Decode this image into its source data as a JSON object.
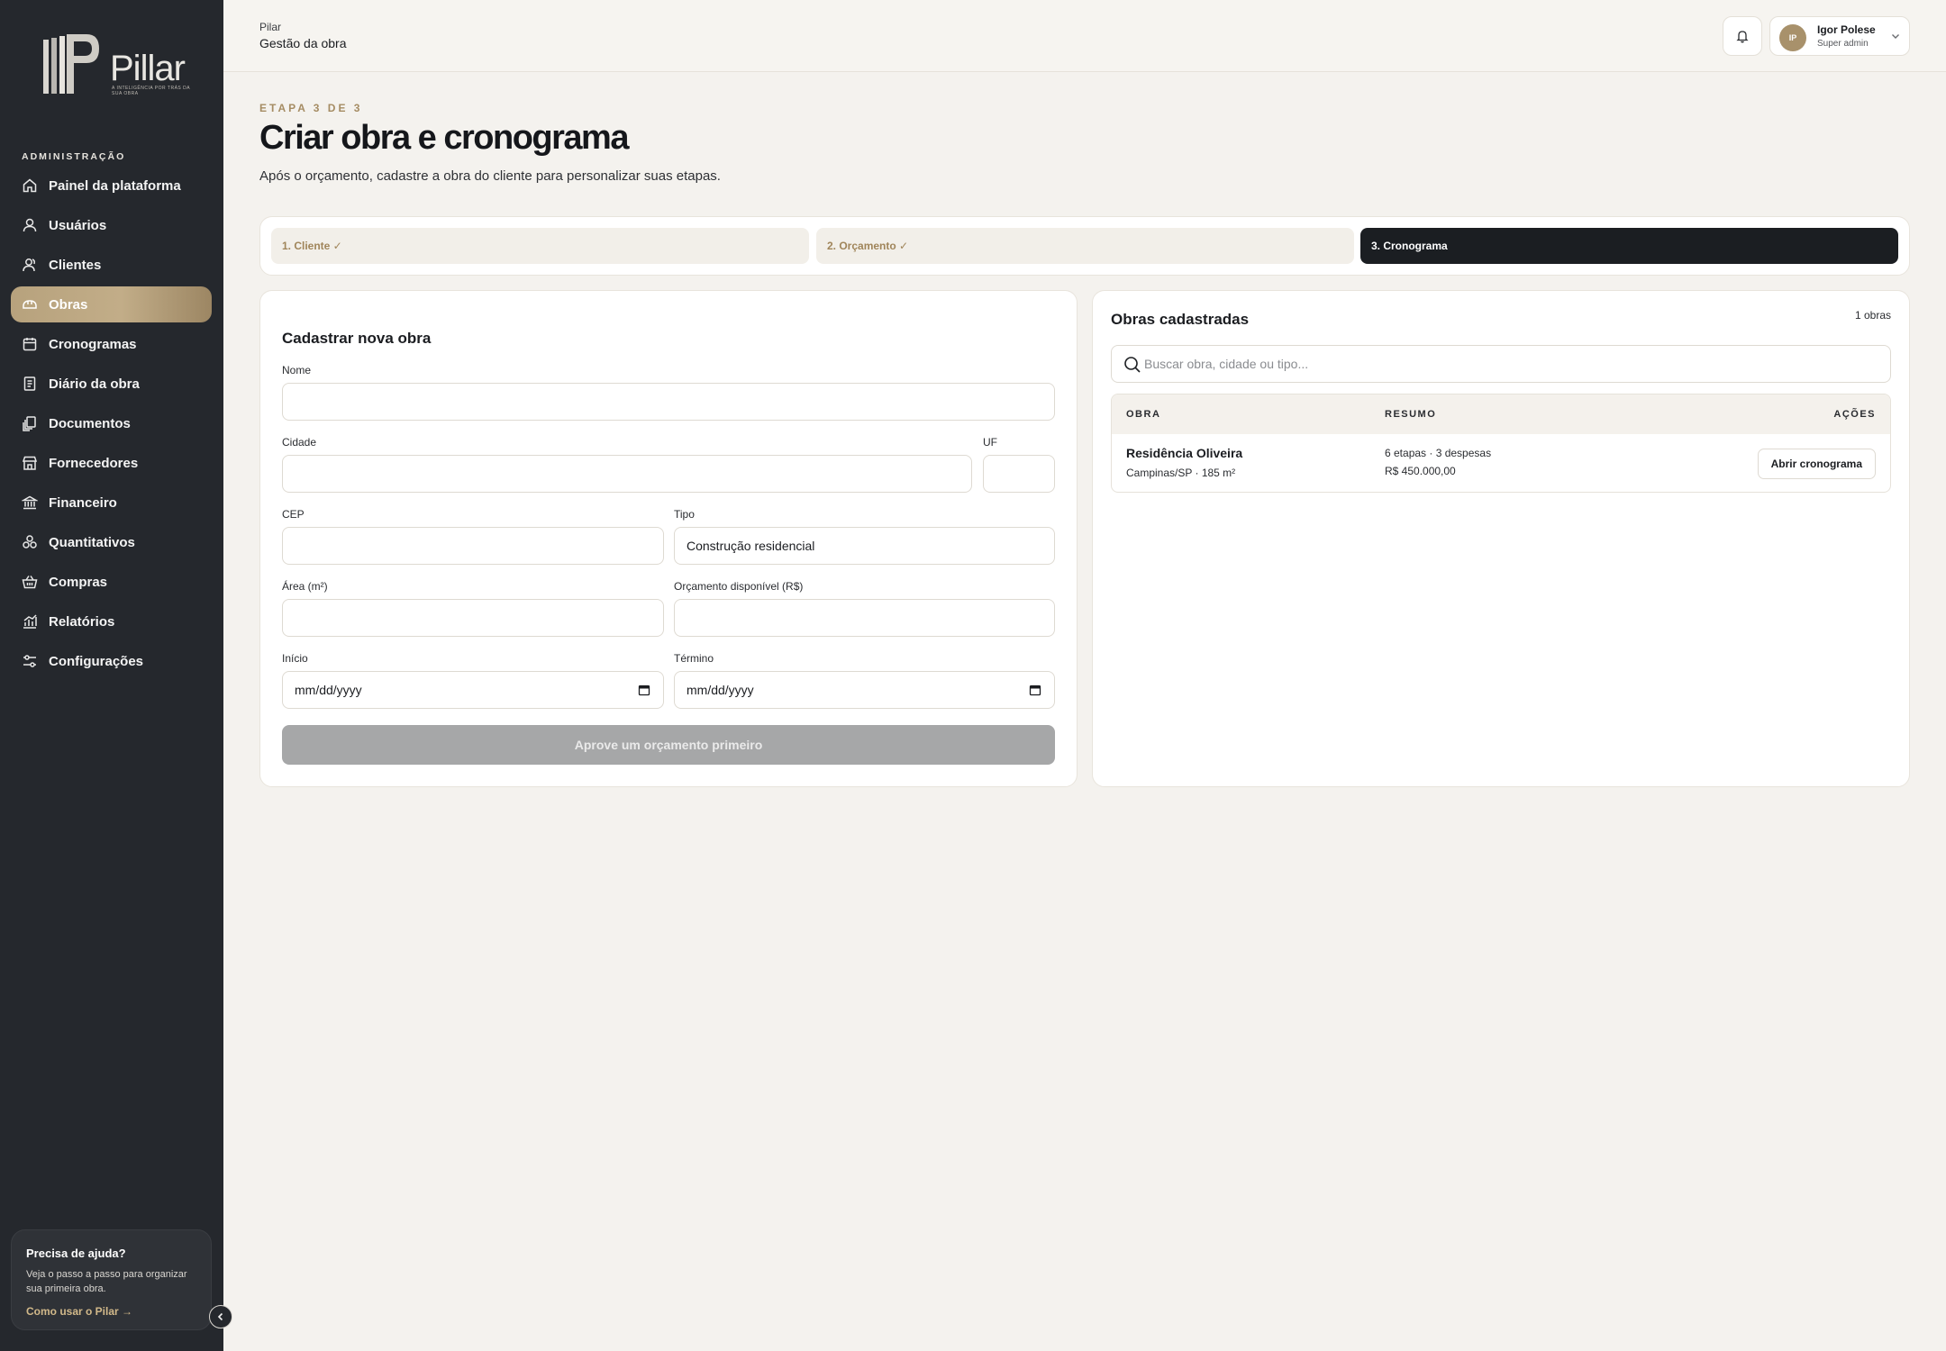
{
  "brand": {
    "name": "Pillar",
    "tagline": "A INTELIGÊNCIA POR TRÁS DA SUA OBRA"
  },
  "sidebar": {
    "section_label": "ADMINISTRAÇÃO",
    "items": [
      {
        "label": "Painel da plataforma",
        "icon": "home-icon"
      },
      {
        "label": "Usuários",
        "icon": "user-icon"
      },
      {
        "label": "Clientes",
        "icon": "users-icon"
      },
      {
        "label": "Obras",
        "icon": "helmet-icon",
        "active": true
      },
      {
        "label": "Cronogramas",
        "icon": "calendar-icon"
      },
      {
        "label": "Diário da obra",
        "icon": "notebook-icon"
      },
      {
        "label": "Documentos",
        "icon": "documents-icon"
      },
      {
        "label": "Fornecedores",
        "icon": "store-icon"
      },
      {
        "label": "Financeiro",
        "icon": "bank-icon"
      },
      {
        "label": "Quantitativos",
        "icon": "boxes-icon"
      },
      {
        "label": "Compras",
        "icon": "basket-icon"
      },
      {
        "label": "Relatórios",
        "icon": "chart-icon"
      },
      {
        "label": "Configurações",
        "icon": "sliders-icon"
      }
    ],
    "help": {
      "title": "Precisa de ajuda?",
      "text": "Veja o passo a passo para organizar sua primeira obra.",
      "link": "Como usar o Pilar →"
    }
  },
  "header": {
    "app": "Pilar",
    "page": "Gestão da obra",
    "user": {
      "initials": "IP",
      "name": "Igor Polese",
      "role": "Super admin"
    }
  },
  "main": {
    "step_label": "ETAPA 3 DE 3",
    "title": "Criar obra e cronograma",
    "subtitle": "Após o orçamento, cadastre a obra do cliente para personalizar suas etapas.",
    "steps": [
      "1. Cliente ✓",
      "2. Orçamento ✓",
      "3. Cronograma"
    ],
    "form": {
      "title": "Cadastrar nova obra",
      "labels": {
        "nome": "Nome",
        "cidade": "Cidade",
        "uf": "UF",
        "cep": "CEP",
        "tipo": "Tipo",
        "area": "Área (m²)",
        "orcamento": "Orçamento disponível (R$)",
        "inicio": "Início",
        "termino": "Término"
      },
      "values": {
        "nome": "",
        "cidade": "",
        "uf": "",
        "cep": "",
        "tipo": "Construção residencial",
        "area": "",
        "orcamento": "",
        "inicio": "mm/dd/yyyy",
        "termino": "mm/dd/yyyy"
      },
      "submit": "Aprove um orçamento primeiro"
    },
    "list": {
      "title": "Obras cadastradas",
      "count": "1 obras",
      "search_placeholder": "Buscar obra, cidade ou tipo...",
      "columns": [
        "OBRA",
        "RESUMO",
        "AÇÕES"
      ],
      "rows": [
        {
          "name": "Residência Oliveira",
          "location": "Campinas/SP · 185 m²",
          "summary1": "6 etapas · 3 despesas",
          "summary2": "R$ 450.000,00",
          "action": "Abrir cronograma"
        }
      ]
    }
  }
}
